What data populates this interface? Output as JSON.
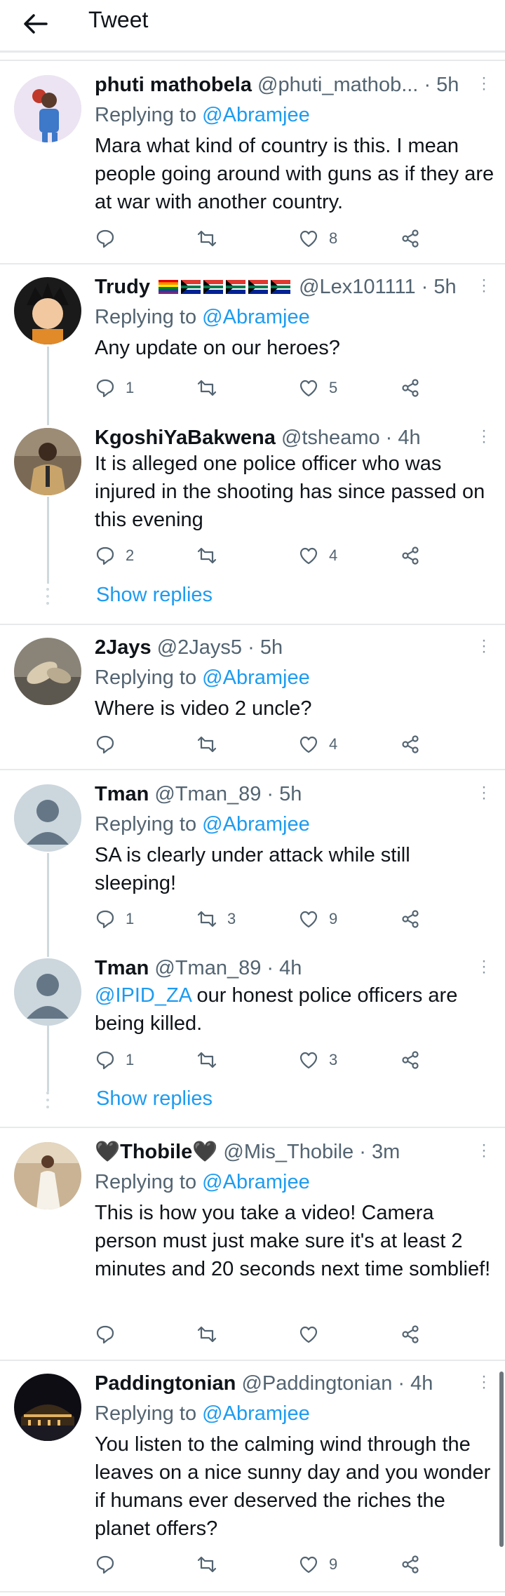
{
  "header": {
    "title": "Tweet"
  },
  "reply_prefix": "Replying to",
  "tweets": [
    {
      "name": "phuti mathobela",
      "handle": "@phuti_mathob...",
      "time": "· 5h",
      "reply_to": "@Abramjee",
      "text": "Mara what kind of country is this. I mean people going around with guns as if they are at war with another country.",
      "replies": "",
      "retweets": "",
      "likes": "8"
    },
    {
      "name": "Trudy",
      "handle": "@Lex101111",
      "time": "· 5h",
      "reply_to": "@Abramjee",
      "text": "Any update on our heroes?",
      "replies": "1",
      "retweets": "",
      "likes": "5"
    },
    {
      "name": "KgoshiYaBakwena",
      "handle": "@tsheamo",
      "time": "· 4h",
      "reply_to": "",
      "text": "It is alleged one police officer who was injured in the shooting has since passed on this evening",
      "replies": "2",
      "retweets": "",
      "likes": "4"
    },
    {
      "name": "2Jays",
      "handle": "@2Jays5",
      "time": "· 5h",
      "reply_to": "@Abramjee",
      "text": "Where is video 2 uncle?",
      "replies": "",
      "retweets": "",
      "likes": "4"
    },
    {
      "name": "Tman",
      "handle": "@Tman_89",
      "time": "· 5h",
      "reply_to": "@Abramjee",
      "text": "SA is clearly under attack while still sleeping!",
      "replies": "1",
      "retweets": "3",
      "likes": "9"
    },
    {
      "name": "Tman",
      "handle": "@Tman_89",
      "time": "· 4h",
      "reply_to": "",
      "mention": "@IPID_ZA",
      "text": " our honest police officers are being killed.",
      "replies": "1",
      "retweets": "",
      "likes": "3"
    },
    {
      "name": "🖤Thobile🖤",
      "handle": "@Mis_Thobile",
      "time": "· 3m",
      "reply_to": "@Abramjee",
      "text": "This is how you take a video! Camera person must just make sure it's at least 2 minutes and 20 seconds next time somblief!",
      "replies": "",
      "retweets": "",
      "likes": ""
    },
    {
      "name": "Paddingtonian",
      "handle": "@Paddingtonian",
      "time": "· 4h",
      "reply_to": "@Abramjee",
      "text": "You listen to the calming wind through the leaves on a nice sunny day and you wonder if humans ever deserved the riches the planet offers?",
      "replies": "",
      "retweets": "",
      "likes": "9"
    }
  ],
  "show_replies_label": "Show replies",
  "icons": {
    "back": "arrow-left-icon",
    "reply": "reply-icon",
    "retweet": "retweet-icon",
    "like": "heart-icon",
    "share": "share-icon",
    "more": "more-vertical-icon"
  },
  "colors": {
    "accent": "#1d9bf0",
    "secondary_text": "#536471",
    "border": "#e7e9ea",
    "thread_line": "#cfd9de"
  }
}
